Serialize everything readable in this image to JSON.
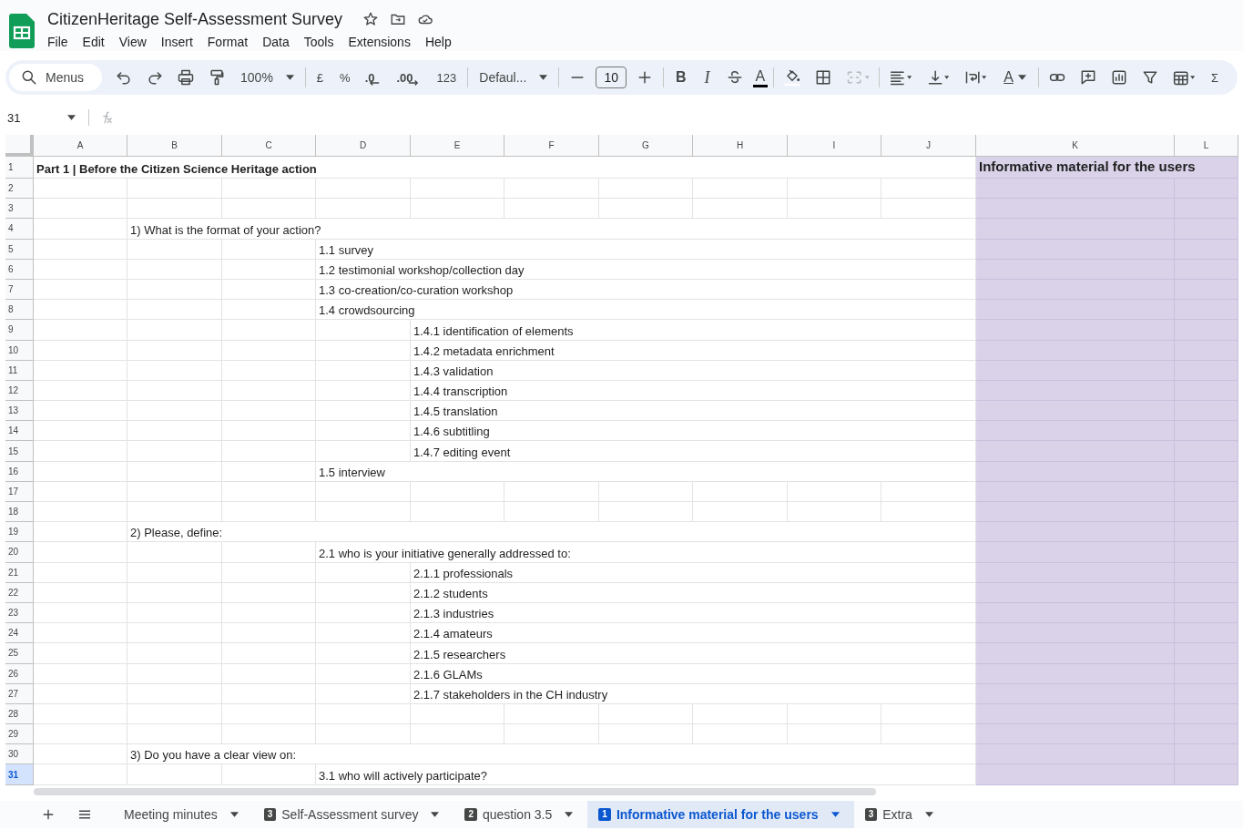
{
  "document": {
    "title": "CitizenHeritage Self-Assessment Survey"
  },
  "menu": [
    "File",
    "Edit",
    "View",
    "Insert",
    "Format",
    "Data",
    "Tools",
    "Extensions",
    "Help"
  ],
  "toolbar": [
    {
      "kind": "search",
      "label": "Menus"
    },
    {
      "kind": "undo"
    },
    {
      "kind": "redo"
    },
    {
      "kind": "print"
    },
    {
      "kind": "paint"
    },
    {
      "kind": "dropdown",
      "label": "100%"
    },
    {
      "kind": "sep"
    },
    {
      "kind": "text",
      "label": "£"
    },
    {
      "kind": "text",
      "label": "%"
    },
    {
      "kind": "decdec",
      "label": ".0"
    },
    {
      "kind": "incdec",
      "label": ".00"
    },
    {
      "kind": "text",
      "label": "123"
    },
    {
      "kind": "sep"
    },
    {
      "kind": "dropdown",
      "label": "Defaul..."
    },
    {
      "kind": "sep"
    },
    {
      "kind": "minus"
    },
    {
      "kind": "size",
      "label": "10"
    },
    {
      "kind": "plus"
    },
    {
      "kind": "sep"
    },
    {
      "kind": "bold",
      "label": "B"
    },
    {
      "kind": "italic",
      "label": "I"
    },
    {
      "kind": "strike"
    },
    {
      "kind": "color",
      "label": "A"
    },
    {
      "kind": "sep"
    },
    {
      "kind": "fill"
    },
    {
      "kind": "borders"
    },
    {
      "kind": "merge"
    },
    {
      "kind": "sep"
    },
    {
      "kind": "align"
    },
    {
      "kind": "valign"
    },
    {
      "kind": "wrap"
    },
    {
      "kind": "rotate",
      "label": "A"
    },
    {
      "kind": "sep"
    },
    {
      "kind": "link"
    },
    {
      "kind": "comment"
    },
    {
      "kind": "chart"
    },
    {
      "kind": "filter"
    },
    {
      "kind": "table"
    },
    {
      "kind": "text",
      "label": "Σ"
    }
  ],
  "name_box": "31",
  "columns": [
    {
      "label": "A",
      "highlighted": false
    },
    {
      "label": "B",
      "highlighted": false
    },
    {
      "label": "C",
      "highlighted": false
    },
    {
      "label": "D",
      "highlighted": false
    },
    {
      "label": "E",
      "highlighted": false
    },
    {
      "label": "F",
      "highlighted": false
    },
    {
      "label": "G",
      "highlighted": false
    },
    {
      "label": "H",
      "highlighted": false
    },
    {
      "label": "I",
      "highlighted": false
    },
    {
      "label": "J",
      "highlighted": false
    },
    {
      "label": "K",
      "highlighted": true
    },
    {
      "label": "L",
      "highlighted": true
    }
  ],
  "rows": [
    {
      "number": "1",
      "selected": false,
      "cells": [
        {
          "kind": "title_a",
          "text": "Part 1 | Before the Citizen Science Heritage action"
        },
        {
          "kind": "heading_k",
          "text": "Informative material for the users"
        }
      ]
    },
    {
      "number": "2",
      "selected": false,
      "cells": []
    },
    {
      "number": "3",
      "selected": false,
      "cells": []
    },
    {
      "number": "4",
      "selected": false,
      "cells": [
        {
          "kind": "text_b",
          "text": "1) What is the format of your action?"
        }
      ]
    },
    {
      "number": "5",
      "selected": false,
      "cells": [
        {
          "kind": "text_d",
          "text": "1.1 survey"
        }
      ]
    },
    {
      "number": "6",
      "selected": false,
      "cells": [
        {
          "kind": "text_d",
          "text": "1.2 testimonial workshop/collection day"
        }
      ]
    },
    {
      "number": "7",
      "selected": false,
      "cells": [
        {
          "kind": "text_d",
          "text": "1.3 co-creation/co-curation workshop"
        }
      ]
    },
    {
      "number": "8",
      "selected": false,
      "cells": [
        {
          "kind": "text_d",
          "text": "1.4 crowdsourcing"
        }
      ]
    },
    {
      "number": "9",
      "selected": false,
      "cells": [
        {
          "kind": "text_e",
          "text": "1.4.1 identification of elements"
        }
      ]
    },
    {
      "number": "10",
      "selected": false,
      "cells": [
        {
          "kind": "text_e",
          "text": "1.4.2 metadata enrichment"
        }
      ]
    },
    {
      "number": "11",
      "selected": false,
      "cells": [
        {
          "kind": "text_e",
          "text": "1.4.3 validation"
        }
      ]
    },
    {
      "number": "12",
      "selected": false,
      "cells": [
        {
          "kind": "text_e",
          "text": "1.4.4 transcription"
        }
      ]
    },
    {
      "number": "13",
      "selected": false,
      "cells": [
        {
          "kind": "text_e",
          "text": "1.4.5 translation"
        }
      ]
    },
    {
      "number": "14",
      "selected": false,
      "cells": [
        {
          "kind": "text_e",
          "text": "1.4.6 subtitling"
        }
      ]
    },
    {
      "number": "15",
      "selected": false,
      "cells": [
        {
          "kind": "text_e",
          "text": "1.4.7 editing event"
        }
      ]
    },
    {
      "number": "16",
      "selected": false,
      "cells": [
        {
          "kind": "text_d",
          "text": "1.5 interview"
        }
      ]
    },
    {
      "number": "17",
      "selected": false,
      "cells": []
    },
    {
      "number": "18",
      "selected": false,
      "cells": []
    },
    {
      "number": "19",
      "selected": false,
      "cells": [
        {
          "kind": "text_b",
          "text": "2) Please, define:"
        }
      ]
    },
    {
      "number": "20",
      "selected": false,
      "cells": [
        {
          "kind": "text_d",
          "text": "2.1 who is your initiative generally addressed to:"
        }
      ]
    },
    {
      "number": "21",
      "selected": false,
      "cells": [
        {
          "kind": "text_e",
          "text": "2.1.1  professionals"
        }
      ]
    },
    {
      "number": "22",
      "selected": false,
      "cells": [
        {
          "kind": "text_e",
          "text": "2.1.2  students"
        }
      ]
    },
    {
      "number": "23",
      "selected": false,
      "cells": [
        {
          "kind": "text_e",
          "text": "2.1.3  industries"
        }
      ]
    },
    {
      "number": "24",
      "selected": false,
      "cells": [
        {
          "kind": "text_e",
          "text": "2.1.4  amateurs"
        }
      ]
    },
    {
      "number": "25",
      "selected": false,
      "cells": [
        {
          "kind": "text_e",
          "text": "2.1.5 researchers"
        }
      ]
    },
    {
      "number": "26",
      "selected": false,
      "cells": [
        {
          "kind": "text_e",
          "text": "2.1.6 GLAMs"
        }
      ]
    },
    {
      "number": "27",
      "selected": false,
      "cells": [
        {
          "kind": "text_e",
          "text": "2.1.7 stakeholders in the CH industry"
        }
      ]
    },
    {
      "number": "28",
      "selected": false,
      "cells": []
    },
    {
      "number": "29",
      "selected": false,
      "cells": []
    },
    {
      "number": "30",
      "selected": false,
      "cells": [
        {
          "kind": "text_b",
          "text": "3) Do you have a clear view on:"
        }
      ]
    },
    {
      "number": "31",
      "selected": true,
      "cells": [
        {
          "kind": "text_d",
          "text": "3.1 who will actively participate?"
        }
      ]
    }
  ],
  "sheet_tabs": [
    {
      "label": "Meeting minutes",
      "selected": false
    },
    {
      "badge": "3",
      "label": "Self-Assessment survey",
      "selected": false
    },
    {
      "badge": "2",
      "label": "question 3.5",
      "selected": false
    },
    {
      "badge": "1",
      "label": "Informative material for the users",
      "selected": true
    },
    {
      "badge": "3",
      "label": "Extra",
      "selected": false
    }
  ]
}
